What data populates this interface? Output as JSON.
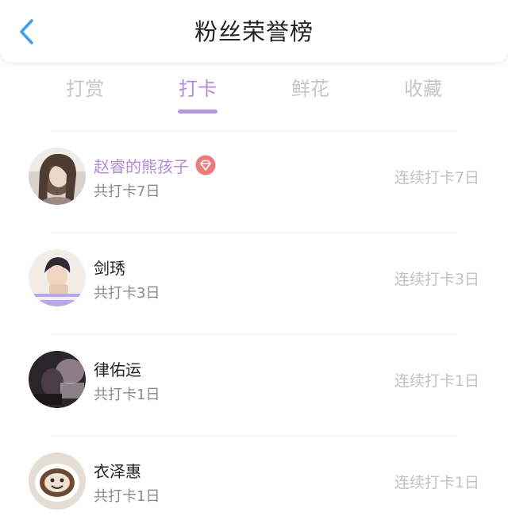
{
  "header": {
    "title": "粉丝荣誉榜",
    "back_icon": "chevron-left-icon",
    "back_color": "#3a9ef5"
  },
  "tabs": [
    {
      "label": "打赏",
      "active": false
    },
    {
      "label": "打卡",
      "active": true
    },
    {
      "label": "鲜花",
      "active": false
    },
    {
      "label": "收藏",
      "active": false
    }
  ],
  "colors": {
    "accent": "#b28be0",
    "badge": "#f07a7a"
  },
  "fans": [
    {
      "name": "赵睿的熊孩子",
      "total": "共打卡7日",
      "streak": "连续打卡7日",
      "highlight": true,
      "badge_icon": "diamond-icon"
    },
    {
      "name": "剑琇",
      "total": "共打卡3日",
      "streak": "连续打卡3日",
      "highlight": false
    },
    {
      "name": "律佑运",
      "total": "共打卡1日",
      "streak": "连续打卡1日",
      "highlight": false
    },
    {
      "name": "衣泽惠",
      "total": "共打卡1日",
      "streak": "连续打卡1日",
      "highlight": false
    }
  ]
}
